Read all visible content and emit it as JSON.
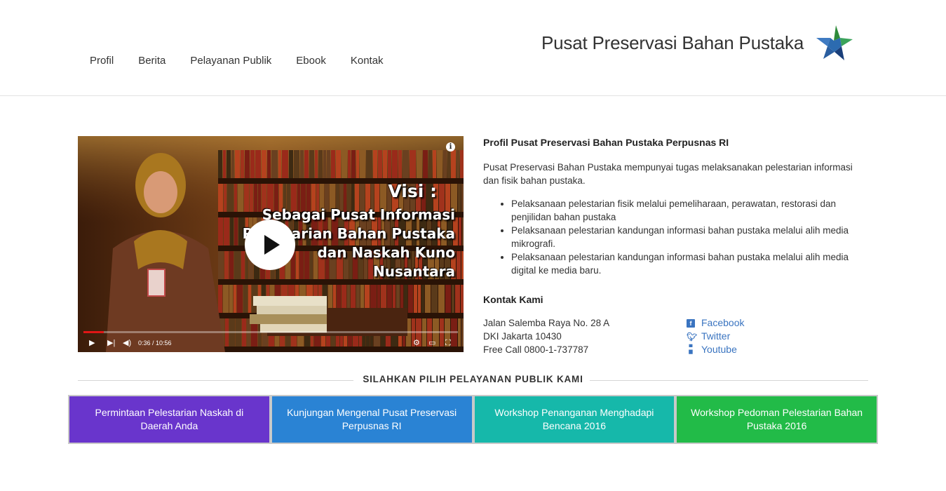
{
  "nav": {
    "items": [
      "Profil",
      "Berita",
      "Pelayanan Publik",
      "Ebook",
      "Kontak"
    ]
  },
  "header": {
    "site_title": "Pusat Preservasi Bahan Pustaka",
    "logo_icon": "star-logo-icon"
  },
  "video": {
    "overlay_title": "Visi :",
    "overlay_lines": [
      "Sebagai Pusat Informasi",
      "Pelestarian Bahan Pustaka",
      "dan Naskah Kuno",
      "Nusantara"
    ],
    "time": "0:36 / 10:56",
    "progress": 0.055,
    "info_label": "i"
  },
  "profile": {
    "heading": "Profil Pusat Preservasi Bahan Pustaka Perpusnas RI",
    "intro": "Pusat Preservasi Bahan Pustaka mempunyai tugas melaksanakan pelestarian informasi dan fisik bahan pustaka.",
    "bullets": [
      "Pelaksanaan pelestarian fisik melalui pemeliharaan, perawatan, restorasi dan penjilidan bahan pustaka",
      "Pelaksanaan pelestarian kandungan informasi bahan pustaka melalui alih media mikrografi.",
      "Pelaksanaan pelestarian kandungan informasi bahan pustaka melalui alih media digital ke media baru."
    ]
  },
  "contact": {
    "heading": "Kontak Kami",
    "address_lines": [
      "Jalan Salemba Raya No. 28 A",
      "DKI Jakarta 10430",
      "Free Call 0800-1-737787"
    ],
    "social": [
      {
        "label": "Facebook",
        "icon": "facebook-icon"
      },
      {
        "label": "Twitter",
        "icon": "twitter-icon"
      },
      {
        "label": "Youtube",
        "icon": "youtube-icon"
      }
    ]
  },
  "services": {
    "title": "SILAHKAN PILIH PELAYANAN PUBLIK KAMI",
    "tiles": [
      {
        "label": "Permintaan Pelestarian Naskah di Daerah Anda",
        "color": "#6935cc"
      },
      {
        "label": "Kunjungan Mengenal Pusat Preservasi Perpusnas RI",
        "color": "#2a83d4"
      },
      {
        "label": "Workshop Penanganan Menghadapi Bencana 2016",
        "color": "#16b8aa"
      },
      {
        "label": "Workshop Pedoman Pelestarian Bahan Pustaka 2016",
        "color": "#22bb48"
      }
    ]
  }
}
